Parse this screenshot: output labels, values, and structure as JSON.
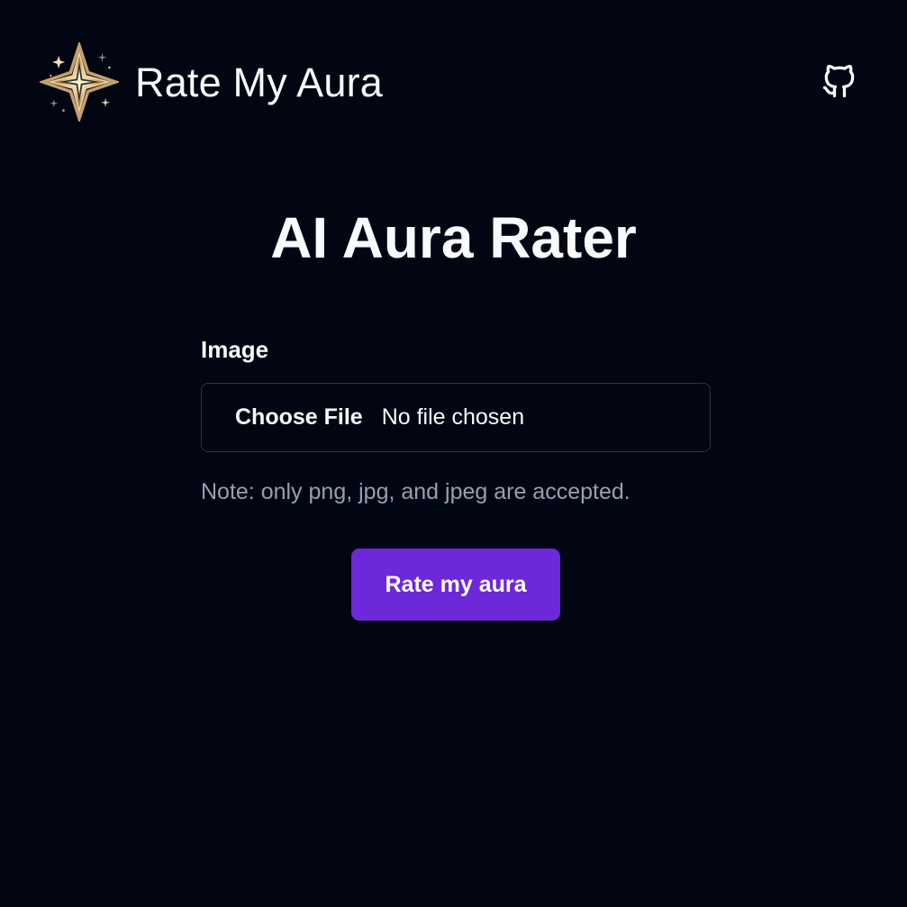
{
  "header": {
    "brand_name": "Rate My Aura",
    "logo_icon": "aura-star-logo-icon",
    "github_icon": "github-icon"
  },
  "main": {
    "title": "AI Aura Rater",
    "form": {
      "image_label": "Image",
      "choose_file_label": "Choose File",
      "file_status": "No file chosen",
      "note": "Note: only png, jpg, and jpeg are accepted.",
      "submit_label": "Rate my aura"
    }
  },
  "colors": {
    "background": "#020612",
    "text": "#f8fafc",
    "muted_text": "#96a0ae",
    "input_border": "#2c3340",
    "button": "#6d28d9",
    "logo_gold": "#d7b074"
  }
}
